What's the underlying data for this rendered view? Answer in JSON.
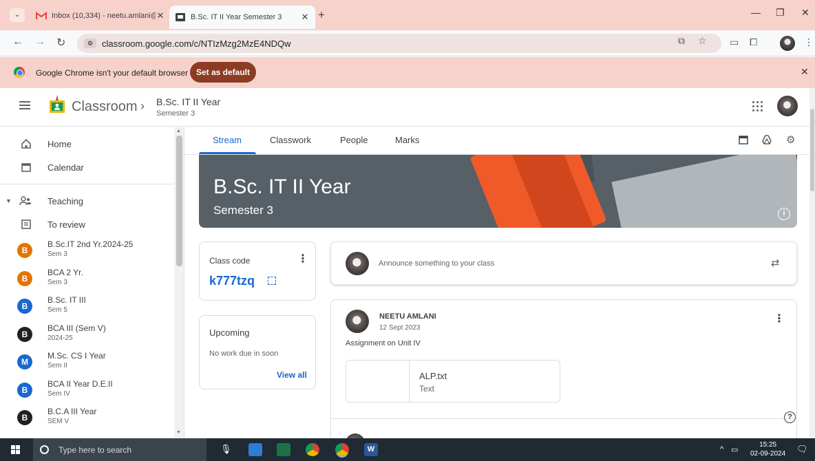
{
  "browser": {
    "tabs": [
      {
        "title": "Inbox (10,334) - neetu.amlani@",
        "active": false
      },
      {
        "title": "B.Sc. IT II Year Semester 3",
        "active": true
      }
    ],
    "url": "classroom.google.com/c/NTIzMzg2MzE4NDQw",
    "infobar": {
      "message": "Google Chrome isn't your default browser",
      "button": "Set as default"
    }
  },
  "header": {
    "app_name": "Classroom",
    "breadcrumb_title": "B.Sc. IT II Year",
    "breadcrumb_sub": "Semester 3"
  },
  "sidebar": {
    "home": "Home",
    "calendar": "Calendar",
    "teaching": "Teaching",
    "to_review": "To review",
    "classes": [
      {
        "initial": "B",
        "name": "B.Sc.IT 2nd Yr.2024-25",
        "sub": "Sem 3",
        "color": "#e37400"
      },
      {
        "initial": "B",
        "name": "BCA 2 Yr.",
        "sub": "Sem 3",
        "color": "#e37400"
      },
      {
        "initial": "B",
        "name": "B.Sc. IT III",
        "sub": "Sem 5",
        "color": "#1967d2"
      },
      {
        "initial": "B",
        "name": "BCA III (Sem V)",
        "sub": "2024-25",
        "color": "#202124"
      },
      {
        "initial": "M",
        "name": "M.Sc. CS I Year",
        "sub": "Sem II",
        "color": "#1967d2"
      },
      {
        "initial": "B",
        "name": "BCA II Year D.E.II",
        "sub": "Sem IV",
        "color": "#1967d2"
      },
      {
        "initial": "B",
        "name": "B.C.A III Year",
        "sub": "SEM V",
        "color": "#202124"
      }
    ]
  },
  "class_tabs": [
    "Stream",
    "Classwork",
    "People",
    "Marks"
  ],
  "banner": {
    "title": "B.Sc. IT II Year",
    "subtitle": "Semester 3"
  },
  "class_code": {
    "label": "Class code",
    "code": "k777tzq"
  },
  "upcoming": {
    "title": "Upcoming",
    "empty": "No work due in soon",
    "view_all": "View all"
  },
  "announce": {
    "placeholder": "Announce something to your class"
  },
  "post": {
    "author": "NEETU AMLANI",
    "date": "12 Sept 2023",
    "body": "Assignment on Unit IV",
    "attachment": {
      "name": "ALP.txt",
      "type": "Text"
    }
  },
  "taskbar": {
    "search_placeholder": "Type here to search",
    "time": "15:25",
    "date": "02-09-2024"
  },
  "colors": {
    "accent": "#1967d2",
    "banner": "#576067",
    "infobar": "#f6d2cb",
    "set_default": "#8c3b24"
  }
}
